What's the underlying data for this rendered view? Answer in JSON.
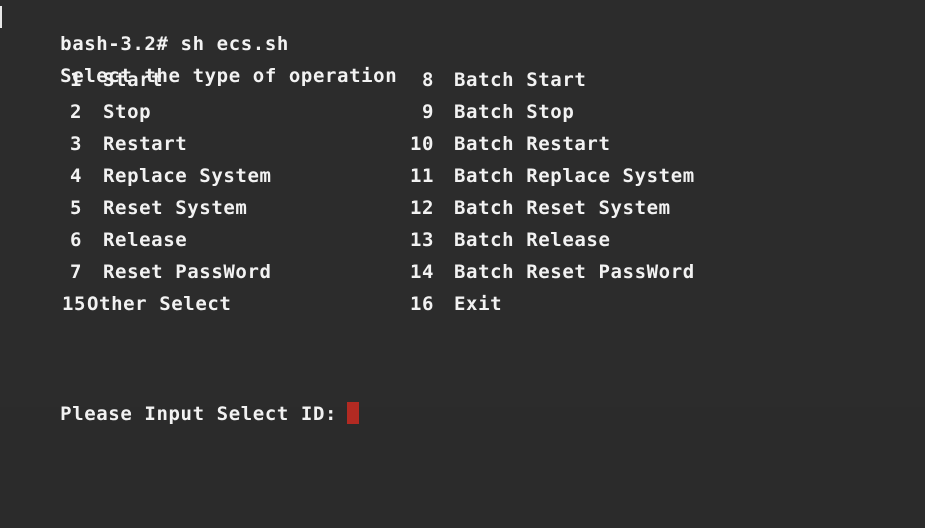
{
  "terminal": {
    "prompt_line": "bash-3.2# sh ecs.sh",
    "heading": "Select the type of operation",
    "options": [
      {
        "left_num": "1",
        "left_label": "Start",
        "right_num": "8",
        "right_label": "Batch Start"
      },
      {
        "left_num": "2",
        "left_label": "Stop",
        "right_num": "9",
        "right_label": "Batch Stop"
      },
      {
        "left_num": "3",
        "left_label": "Restart",
        "right_num": "10",
        "right_label": "Batch Restart"
      },
      {
        "left_num": "4",
        "left_label": "Replace System",
        "right_num": "11",
        "right_label": "Batch Replace System"
      },
      {
        "left_num": "5",
        "left_label": "Reset System",
        "right_num": "12",
        "right_label": "Batch Reset System"
      },
      {
        "left_num": "6",
        "left_label": "Release",
        "right_num": "13",
        "right_label": "Batch Release"
      },
      {
        "left_num": "7",
        "left_label": "Reset PassWord",
        "right_num": "14",
        "right_label": "Batch Reset PassWord"
      },
      {
        "left_num": "15",
        "left_label": "Other Select",
        "right_num": "16",
        "right_label": "Exit"
      }
    ],
    "input_prompt": "Please Input Select ID:",
    "colors": {
      "background": "#2c2c2c",
      "text": "#f2f2f2",
      "cursor": "#b22a22"
    }
  }
}
